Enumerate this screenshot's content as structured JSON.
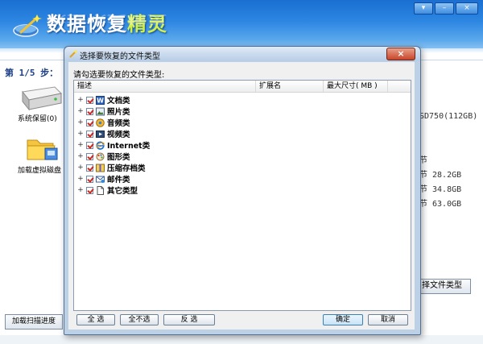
{
  "app": {
    "title_main": "数据恢复",
    "title_highlight": "精灵",
    "step_label": "第 1/5 步：",
    "window_buttons": [
      "▾",
      "–",
      "×"
    ]
  },
  "left_panel": {
    "drive_label": "系统保留(0)",
    "folder_label": "加载虚拟磁盘"
  },
  "right_panel": {
    "disk_name": "SD750(112GB)",
    "rows": [
      {
        "text": "节"
      },
      {
        "text": "节   28.2GB"
      },
      {
        "text": "节   34.8GB"
      },
      {
        "text": "节   63.0GB"
      }
    ],
    "select_type_button": "择文件类型",
    "load_progress_button": "加载扫描进度"
  },
  "dialog": {
    "title": "选择要恢复的文件类型",
    "prompt": "请勾选要恢复的文件类型:",
    "columns": [
      "描述",
      "扩展名",
      "最大尺寸( MB )"
    ],
    "file_types": [
      {
        "label": "文档类",
        "icon": "word-document-icon",
        "checked": true
      },
      {
        "label": "照片类",
        "icon": "photo-icon",
        "checked": true
      },
      {
        "label": "音频类",
        "icon": "audio-icon",
        "checked": true
      },
      {
        "label": "视频类",
        "icon": "video-icon",
        "checked": true
      },
      {
        "label": "Internet类",
        "icon": "internet-explorer-icon",
        "checked": true
      },
      {
        "label": "图形类",
        "icon": "graphics-icon",
        "checked": true
      },
      {
        "label": "压缩存档类",
        "icon": "archive-icon",
        "checked": true
      },
      {
        "label": "邮件类",
        "icon": "mail-icon",
        "checked": true
      },
      {
        "label": "其它类型",
        "icon": "other-file-icon",
        "checked": true
      }
    ],
    "buttons": {
      "select_all": "全 选",
      "select_none": "全不选",
      "invert": "反 选",
      "ok": "确定",
      "cancel": "取消"
    }
  },
  "colors": {
    "banner_top": "#1a6fd0",
    "banner_bottom": "#9fcdf2",
    "title_highlight": "#d2f04a",
    "check_mark": "#d0261f"
  }
}
